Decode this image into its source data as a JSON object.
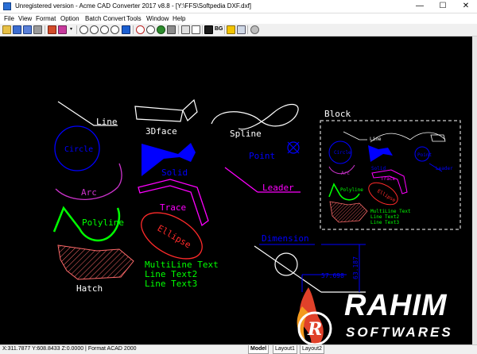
{
  "window": {
    "title": "Unregistered version - Acme CAD Converter 2017 v8.8 - [Y:\\FFS\\Softpedia DXF.dxf]",
    "minimize": "—",
    "maximize": "☐",
    "close": "✕"
  },
  "menu": {
    "items": [
      "File",
      "View",
      "Format",
      "Option",
      "Batch Convert",
      "Tools",
      "Window",
      "Help"
    ]
  },
  "toolbar": {
    "bg_label": "BG",
    "icons": [
      "open-icon",
      "save-icon",
      "save-as-icon",
      "print-icon",
      "settings-icon",
      "dropdown-icon",
      "zoom-in-icon",
      "zoom-out-icon",
      "zoom-window-icon",
      "zoom-extents-icon",
      "pan-icon",
      "find-icon",
      "layer-icon",
      "layout-icon",
      "bw-icon",
      "background-icon",
      "warning-icon",
      "properties-icon",
      "info-icon"
    ]
  },
  "drawing": {
    "labels": {
      "line": "Line",
      "face3d": "3Dface",
      "spline": "Spline",
      "block": "Block",
      "circle": "Circle",
      "solid": "Solid",
      "point": "Point",
      "arc": "Arc",
      "leader": "Leader",
      "trace": "Trace",
      "polyline": "Polyline",
      "ellipse": "Ellipse",
      "dimension": "Dimension",
      "mtext1": "MultiLine Text",
      "mtext2": "Line Text2",
      "mtext3": "Line Text3",
      "hatch": "Hatch",
      "dim_value1": "63.187",
      "dim_value2": "57.698"
    },
    "colors": {
      "white": "#ffffff",
      "blue": "#0000ff",
      "magenta": "#ff00ff",
      "red": "#ff2a2a",
      "green": "#00ff00",
      "hatch": "#ff6a6a"
    }
  },
  "status": {
    "coords": "X:311.7877 Y:608.8433 Z:0.0000 | Format ACAD 2000",
    "tabs": [
      "Model",
      "Layout1",
      "Layout2"
    ]
  },
  "watermark": {
    "title": "RAHIM",
    "subtitle": "SOFTWARES"
  }
}
